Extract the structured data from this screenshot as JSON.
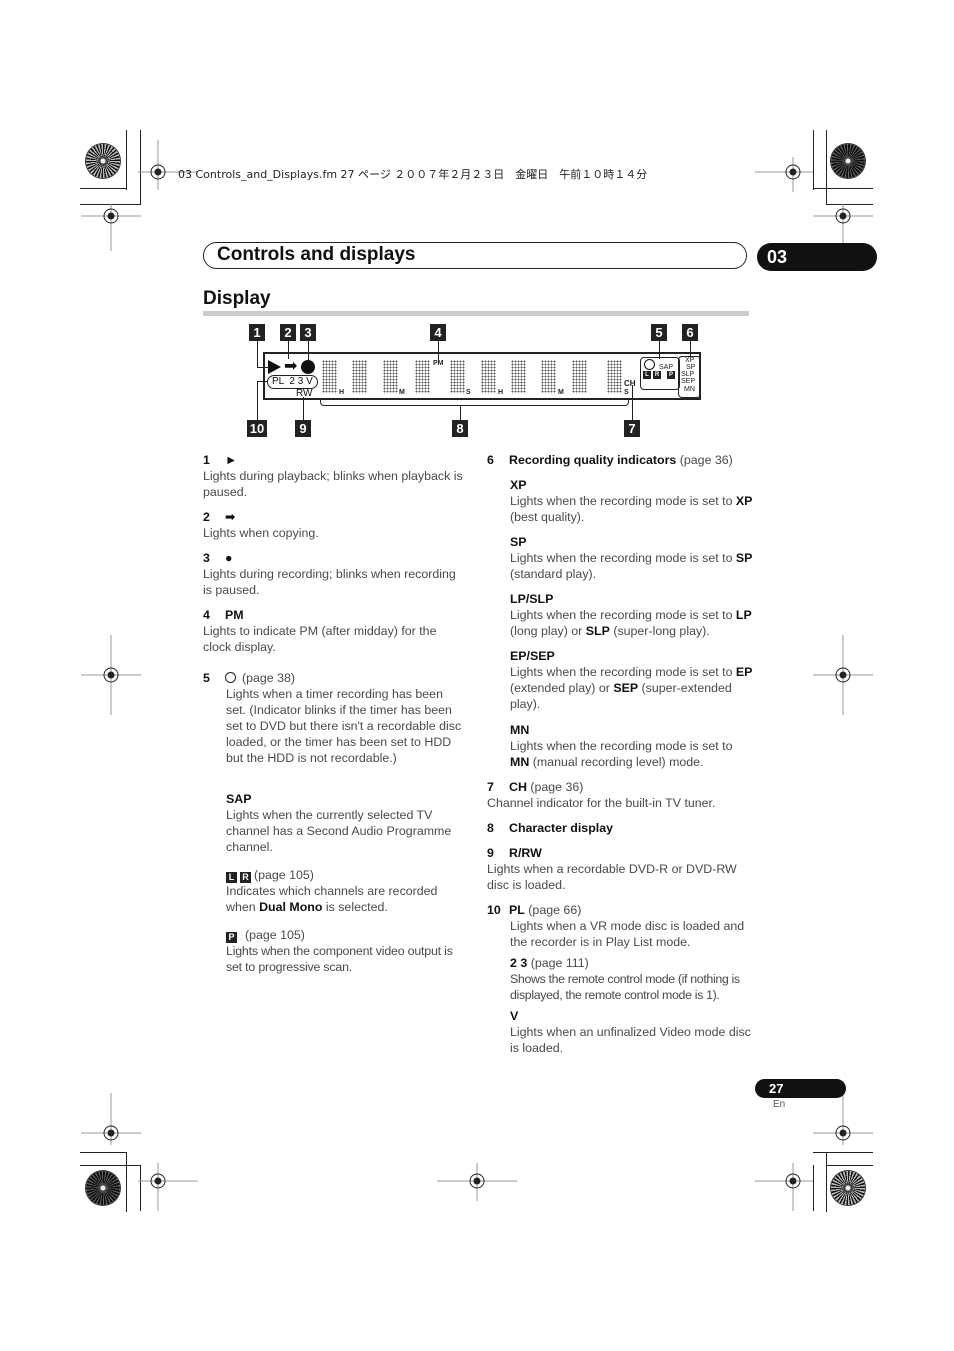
{
  "print_header": "03 Controls_and_Displays.fm  27 ページ  ２００７年２月２３日　金曜日　午前１０時１４分",
  "chapter": {
    "title": "Controls and displays",
    "number": "03"
  },
  "section": {
    "title": "Display"
  },
  "diagram": {
    "callouts": [
      "1",
      "2",
      "3",
      "4",
      "5",
      "6",
      "7",
      "8",
      "9",
      "10"
    ],
    "lcd": {
      "pl_label": "PL  2 3 V",
      "rw_label": "RW",
      "pm_label": "PM",
      "ch_label": "CH",
      "s_label": "S",
      "digit_subs": [
        "H",
        "M",
        "S",
        "H",
        "M"
      ],
      "sap_label": "SAP",
      "lr_glyphs": [
        "L",
        "R",
        "P"
      ],
      "quality": [
        "XP",
        "SP",
        "SLP",
        "SEP",
        "MN"
      ]
    }
  },
  "left_column": {
    "items": [
      {
        "num": "1",
        "symbol": "►",
        "desc": "Lights during playback; blinks when playback is paused."
      },
      {
        "num": "2",
        "symbol": "➡",
        "desc": "Lights when copying."
      },
      {
        "num": "3",
        "symbol": "●",
        "desc": "Lights during recording; blinks when recording is paused."
      },
      {
        "num": "4",
        "symbol": "PM",
        "desc": "Lights to indicate PM (after midday) for the clock display."
      }
    ],
    "item5": {
      "num": "5",
      "page_ref": "(page 38)",
      "desc": "Lights when a timer recording has been set. (Indicator blinks if the timer has been set to DVD but there isn't a recordable disc loaded, or the timer has been set to HDD but the HDD is not recordable.)",
      "sap": {
        "title": "SAP",
        "desc": "Lights when the currently selected TV channel has a Second Audio Programme channel."
      },
      "lr": {
        "glyphs": [
          "L",
          "R"
        ],
        "page_ref": "(page 105)",
        "desc_pre": "Indicates which channels are recorded when ",
        "desc_bold": "Dual Mono",
        "desc_post": " is selected."
      },
      "p": {
        "glyph": "P",
        "page_ref": "(page 105)",
        "desc": "Lights when the component video output is set to progressive scan."
      }
    }
  },
  "right_column": {
    "item6": {
      "num": "6",
      "title": "Recording quality indicators",
      "page_ref": "(page 36)",
      "modes": [
        {
          "title": "XP",
          "desc_pre": "Lights when the recording mode is set to ",
          "b1": "XP",
          "t1": " (best quality).",
          "b2": "",
          "t2": ""
        },
        {
          "title": "SP",
          "desc_pre": "Lights when the recording mode is set to ",
          "b1": "SP",
          "t1": " (standard play).",
          "b2": "",
          "t2": ""
        },
        {
          "title": "LP/SLP",
          "desc_pre": "Lights when the recording mode is set to ",
          "b1": "LP",
          "t1": " (long play) or ",
          "b2": "SLP",
          "t2": " (super-long play)."
        },
        {
          "title": "EP/SEP",
          "desc_pre": "Lights when the recording mode is set to ",
          "b1": "EP",
          "t1": " (extended play) or ",
          "b2": "SEP",
          "t2": " (super-extended play)."
        },
        {
          "title": "MN",
          "desc_pre": "Lights when the recording mode is set to ",
          "b1": "MN",
          "t1": " (manual recording level) mode.",
          "b2": "",
          "t2": ""
        }
      ]
    },
    "item7": {
      "num": "7",
      "title": "CH",
      "page_ref": "(page 36)",
      "desc": "Channel indicator for the built-in TV tuner."
    },
    "item8": {
      "num": "8",
      "title": "Character display"
    },
    "item9": {
      "num": "9",
      "title": "R/RW",
      "desc": "Lights when a recordable DVD-R or DVD-RW disc is loaded."
    },
    "item10": {
      "num": "10",
      "title": "PL",
      "page_ref": "(page 66)",
      "desc": "Lights when a VR mode disc is loaded and the recorder is in Play List mode.",
      "sub1": {
        "title": "2 3",
        "page_ref": "(page 111)",
        "desc": "Shows the remote control mode (if nothing is displayed, the remote control mode is 1)."
      },
      "sub2": {
        "title": "V",
        "desc": "Lights when an unfinalized Video mode disc is loaded."
      }
    }
  },
  "footer": {
    "page_number": "27",
    "language": "En"
  }
}
